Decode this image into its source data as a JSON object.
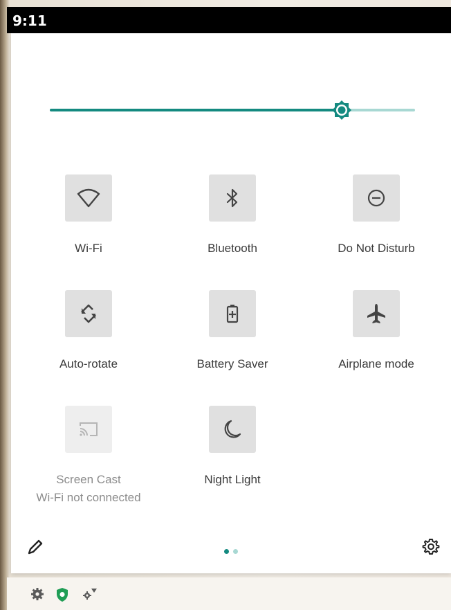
{
  "statusbar": {
    "time": "9:11"
  },
  "brightness": {
    "level": 0.8
  },
  "tiles": [
    {
      "label": "Wi-Fi",
      "sublabel": "",
      "icon": "wifi-icon",
      "enabled": true
    },
    {
      "label": "Bluetooth",
      "sublabel": "",
      "icon": "bluetooth-icon",
      "enabled": true
    },
    {
      "label": "Do Not Disturb",
      "sublabel": "",
      "icon": "do-not-disturb-icon",
      "enabled": true
    },
    {
      "label": "Auto-rotate",
      "sublabel": "",
      "icon": "auto-rotate-icon",
      "enabled": true
    },
    {
      "label": "Battery Saver",
      "sublabel": "",
      "icon": "battery-saver-icon",
      "enabled": true
    },
    {
      "label": "Airplane mode",
      "sublabel": "",
      "icon": "airplane-icon",
      "enabled": true
    },
    {
      "label": "Screen Cast",
      "sublabel": "Wi-Fi not connected",
      "icon": "screen-cast-icon",
      "enabled": false
    },
    {
      "label": "Night Light",
      "sublabel": "",
      "icon": "night-light-icon",
      "enabled": true
    }
  ],
  "pager": {
    "current": 1,
    "total": 2
  },
  "colors": {
    "accent": "#148a80",
    "accent_light": "#a8d8d3",
    "icon": "#444444",
    "tile_bg": "#e0e0e0"
  },
  "notifications": [
    "settings-icon",
    "shield-icon",
    "network-settings-icon"
  ]
}
